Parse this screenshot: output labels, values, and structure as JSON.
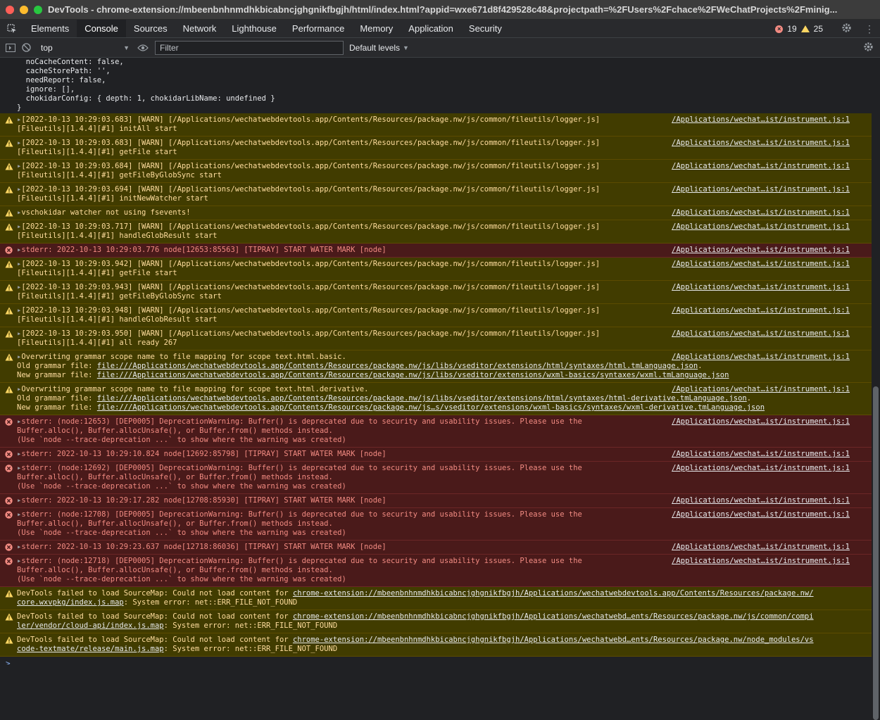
{
  "window": {
    "title": "DevTools - chrome-extension://mbeenbnhnmdhkbicabncjghgnikfbgjh/html/index.html?appid=wxe671d8f429528c48&projectpath=%2FUsers%2Fchace%2FWeChatProjects%2Fminig..."
  },
  "tabs": [
    "Elements",
    "Console",
    "Sources",
    "Network",
    "Lighthouse",
    "Performance",
    "Memory",
    "Application",
    "Security"
  ],
  "badges": {
    "errors": "19",
    "warnings": "25"
  },
  "toolbar": {
    "context": "top",
    "filter_placeholder": "Filter",
    "levels": "Default levels"
  },
  "colors": {
    "warn_bg": "#413c00",
    "err_bg": "#4a1a1a",
    "warn_text": "#ffdd9e",
    "err_text": "#f28b82",
    "selected_tab": "#202124"
  },
  "messages": [
    {
      "level": "plain",
      "link": "",
      "lines": [
        "  noCacheContent: false,",
        "  cacheStorePath: '',",
        "  needReport: false,",
        "  ignore: [],",
        "  chokidarConfig: { depth: 1, chokidarLibName: undefined }",
        "}"
      ]
    },
    {
      "level": "warn",
      "link": "/Applications/wechat…ist/instrument.js:1",
      "lines": [
        "▸[2022-10-13 10:29:03.683] [WARN] [/Applications/wechatwebdevtools.app/Contents/Resources/package.nw/js/common/fileutils/logger.js]",
        "[Fileutils][1.4.4][#1] initAll start"
      ]
    },
    {
      "level": "warn",
      "link": "/Applications/wechat…ist/instrument.js:1",
      "lines": [
        "▸[2022-10-13 10:29:03.683] [WARN] [/Applications/wechatwebdevtools.app/Contents/Resources/package.nw/js/common/fileutils/logger.js]",
        "[Fileutils][1.4.4][#1] getFile start"
      ]
    },
    {
      "level": "warn",
      "link": "/Applications/wechat…ist/instrument.js:1",
      "lines": [
        "▸[2022-10-13 10:29:03.684] [WARN] [/Applications/wechatwebdevtools.app/Contents/Resources/package.nw/js/common/fileutils/logger.js]",
        "[Fileutils][1.4.4][#1] getFileByGlobSync start"
      ]
    },
    {
      "level": "warn",
      "link": "/Applications/wechat…ist/instrument.js:1",
      "lines": [
        "▸[2022-10-13 10:29:03.694] [WARN] [/Applications/wechatwebdevtools.app/Contents/Resources/package.nw/js/common/fileutils/logger.js]",
        "[Fileutils][1.4.4][#1] initNewWatcher start"
      ]
    },
    {
      "level": "warn",
      "link": "/Applications/wechat…ist/instrument.js:1",
      "lines": [
        "▸vschokidar watcher not using fsevents!"
      ]
    },
    {
      "level": "warn",
      "link": "/Applications/wechat…ist/instrument.js:1",
      "lines": [
        "▸[2022-10-13 10:29:03.717] [WARN] [/Applications/wechatwebdevtools.app/Contents/Resources/package.nw/js/common/fileutils/logger.js]",
        "[Fileutils][1.4.4][#1] handleGlobResult start"
      ]
    },
    {
      "level": "err",
      "link": "/Applications/wechat…ist/instrument.js:1",
      "lines": [
        "▸stderr: 2022-10-13 10:29:03.776 node[12653:85563] [TIPRAY] START WATER MARK [node]"
      ]
    },
    {
      "level": "warn",
      "link": "/Applications/wechat…ist/instrument.js:1",
      "lines": [
        "▸[2022-10-13 10:29:03.942] [WARN] [/Applications/wechatwebdevtools.app/Contents/Resources/package.nw/js/common/fileutils/logger.js]",
        "[Fileutils][1.4.4][#1] getFile start"
      ]
    },
    {
      "level": "warn",
      "link": "/Applications/wechat…ist/instrument.js:1",
      "lines": [
        "▸[2022-10-13 10:29:03.943] [WARN] [/Applications/wechatwebdevtools.app/Contents/Resources/package.nw/js/common/fileutils/logger.js]",
        "[Fileutils][1.4.4][#1] getFileByGlobSync start"
      ]
    },
    {
      "level": "warn",
      "link": "/Applications/wechat…ist/instrument.js:1",
      "lines": [
        "▸[2022-10-13 10:29:03.948] [WARN] [/Applications/wechatwebdevtools.app/Contents/Resources/package.nw/js/common/fileutils/logger.js]",
        "[Fileutils][1.4.4][#1] handleGlobResult start"
      ]
    },
    {
      "level": "warn",
      "link": "/Applications/wechat…ist/instrument.js:1",
      "lines": [
        "▸[2022-10-13 10:29:03.950] [WARN] [/Applications/wechatwebdevtools.app/Contents/Resources/package.nw/js/common/fileutils/logger.js]",
        "[Fileutils][1.4.4][#1] all ready 267"
      ]
    },
    {
      "level": "warn",
      "link": "/Applications/wechat…ist/instrument.js:1",
      "lines": [
        "▸Overwriting grammar scope name to file mapping for scope text.html.basic.",
        "Old grammar file: file:///Applications/wechatwebdevtools.app/Contents/Resources/package.nw/js/libs/vseditor/extensions/html/syntaxes/html.tmLanguage.json.",
        "New grammar file: file:///Applications/wechatwebdevtools.app/Contents/Resources/package.nw/js/libs/vseditor/extensions/wxml-basics/syntaxes/wxml.tmLanguage.json"
      ]
    },
    {
      "level": "warn",
      "link": "/Applications/wechat…ist/instrument.js:1",
      "lines": [
        "▸Overwriting grammar scope name to file mapping for scope text.html.derivative.",
        "Old grammar file: file:///Applications/wechatwebdevtools.app/Contents/Resources/package.nw/js/libs/vseditor/extensions/html/syntaxes/html-derivative.tmLanguage.json.",
        "New grammar file: file:///Applications/wechatwebdevtools.app/Contents/Resources/package.nw/js…s/vseditor/extensions/wxml-basics/syntaxes/wxml-derivative.tmLanguage.json"
      ]
    },
    {
      "level": "err",
      "link": "/Applications/wechat…ist/instrument.js:1",
      "lines": [
        "▸stderr: (node:12653) [DEP0005] DeprecationWarning: Buffer() is deprecated due to security and usability issues. Please use the",
        "Buffer.alloc(), Buffer.allocUnsafe(), or Buffer.from() methods instead.",
        "(Use `node --trace-deprecation ...` to show where the warning was created)"
      ]
    },
    {
      "level": "err",
      "link": "/Applications/wechat…ist/instrument.js:1",
      "lines": [
        "▸stderr: 2022-10-13 10:29:10.824 node[12692:85798] [TIPRAY] START WATER MARK [node]"
      ]
    },
    {
      "level": "err",
      "link": "/Applications/wechat…ist/instrument.js:1",
      "lines": [
        "▸stderr: (node:12692) [DEP0005] DeprecationWarning: Buffer() is deprecated due to security and usability issues. Please use the",
        "Buffer.alloc(), Buffer.allocUnsafe(), or Buffer.from() methods instead.",
        "(Use `node --trace-deprecation ...` to show where the warning was created)"
      ]
    },
    {
      "level": "err",
      "link": "/Applications/wechat…ist/instrument.js:1",
      "lines": [
        "▸stderr: 2022-10-13 10:29:17.282 node[12708:85930] [TIPRAY] START WATER MARK [node]"
      ]
    },
    {
      "level": "err",
      "link": "/Applications/wechat…ist/instrument.js:1",
      "lines": [
        "▸stderr: (node:12708) [DEP0005] DeprecationWarning: Buffer() is deprecated due to security and usability issues. Please use the",
        "Buffer.alloc(), Buffer.allocUnsafe(), or Buffer.from() methods instead.",
        "(Use `node --trace-deprecation ...` to show where the warning was created)"
      ]
    },
    {
      "level": "err",
      "link": "/Applications/wechat…ist/instrument.js:1",
      "lines": [
        "▸stderr: 2022-10-13 10:29:23.637 node[12718:86036] [TIPRAY] START WATER MARK [node]"
      ]
    },
    {
      "level": "err",
      "link": "/Applications/wechat…ist/instrument.js:1",
      "lines": [
        "▸stderr: (node:12718) [DEP0005] DeprecationWarning: Buffer() is deprecated due to security and usability issues. Please use the",
        "Buffer.alloc(), Buffer.allocUnsafe(), or Buffer.from() methods instead.",
        "(Use `node --trace-deprecation ...` to show where the warning was created)"
      ]
    },
    {
      "level": "warn",
      "link": "",
      "lines": [
        "DevTools failed to load SourceMap: Could not load content for chrome-extension://mbeenbnhnmdhkbicabncjghgnikfbgjh/Applications/wechatwebdevtools.app/Contents/Resources/package.nw/",
        "core.wxvpkg/index.js.map: System error: net::ERR_FILE_NOT_FOUND"
      ]
    },
    {
      "level": "warn",
      "link": "",
      "lines": [
        "DevTools failed to load SourceMap: Could not load content for chrome-extension://mbeenbnhnmdhkbicabncjghgnikfbgjh/Applications/wechatwebd…ents/Resources/package.nw/js/common/compi",
        "ler/vendor/cloud-api/index.js.map: System error: net::ERR_FILE_NOT_FOUND"
      ]
    },
    {
      "level": "warn",
      "link": "",
      "lines": [
        "DevTools failed to load SourceMap: Could not load content for chrome-extension://mbeenbnhnmdhkbicabncjghgnikfbgjh/Applications/wechatwebd…ents/Resources/package.nw/node_modules/vs",
        "code-textmate/release/main.js.map: System error: net::ERR_FILE_NOT_FOUND"
      ]
    }
  ],
  "prompt": ">"
}
